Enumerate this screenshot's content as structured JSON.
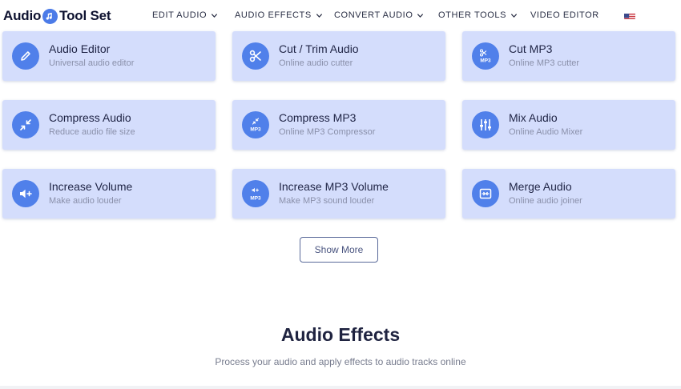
{
  "logo": {
    "left": "Audio",
    "right": "Tool Set"
  },
  "nav": [
    {
      "label": "EDIT AUDIO",
      "dropdown": true
    },
    {
      "label": "AUDIO EFFECTS",
      "dropdown": true
    },
    {
      "label": "CONVERT AUDIO",
      "dropdown": true
    },
    {
      "label": "OTHER TOOLS",
      "dropdown": true
    },
    {
      "label": "VIDEO EDITOR",
      "dropdown": false
    }
  ],
  "language_flag": "us-flag-icon",
  "tools": [
    {
      "title": "Audio Editor",
      "subtitle": "Universal audio editor",
      "icon": "pencil-icon"
    },
    {
      "title": "Cut / Trim Audio",
      "subtitle": "Online audio cutter",
      "icon": "scissors-icon"
    },
    {
      "title": "Cut MP3",
      "subtitle": "Online MP3 cutter",
      "icon": "cut-mp3-icon",
      "icon_text": "MP3"
    },
    {
      "title": "Compress Audio",
      "subtitle": "Reduce audio file size",
      "icon": "compress-icon"
    },
    {
      "title": "Compress MP3",
      "subtitle": "Online MP3 Compressor",
      "icon": "compress-mp3-icon",
      "icon_text": "MP3"
    },
    {
      "title": "Mix Audio",
      "subtitle": "Online Audio Mixer",
      "icon": "mixer-sliders-icon"
    },
    {
      "title": "Increase Volume",
      "subtitle": "Make audio louder",
      "icon": "volume-up-icon"
    },
    {
      "title": "Increase MP3 Volume",
      "subtitle": "Make MP3 sound louder",
      "icon": "volume-mp3-icon",
      "icon_text": "MP3"
    },
    {
      "title": "Merge Audio",
      "subtitle": "Online audio joiner",
      "icon": "merge-icon"
    }
  ],
  "show_more_label": "Show More",
  "section": {
    "title": "Audio Effects",
    "subtitle": "Process your audio and apply effects to audio tracks online"
  },
  "colors": {
    "accent": "#5080ea",
    "card_bg": "#d4ddfc",
    "text_dark": "#1f2445",
    "text_muted": "#8a90aa"
  }
}
